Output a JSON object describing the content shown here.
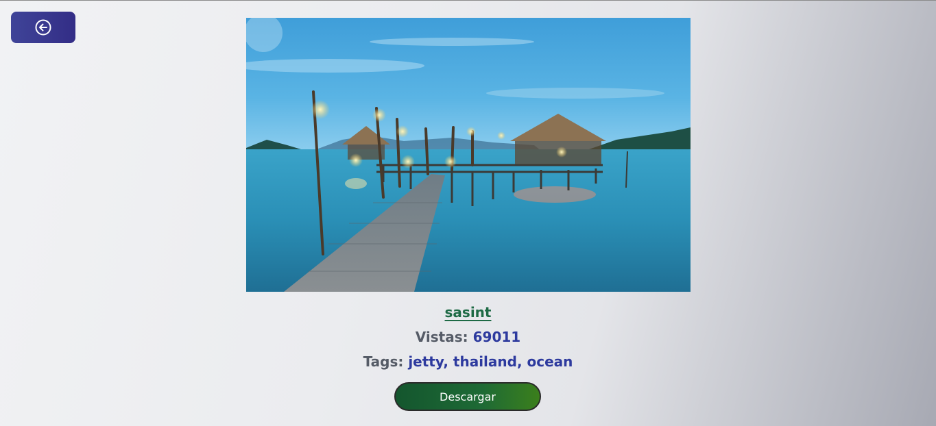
{
  "back_button": {
    "icon": "arrow-left-circle-icon"
  },
  "image": {
    "subject": "jetty"
  },
  "author": {
    "name": "sasint"
  },
  "views": {
    "label": "Vistas:",
    "value": "69011"
  },
  "tags": {
    "label": "Tags:",
    "value": "jetty, thailand, ocean"
  },
  "download": {
    "label": "Descargar"
  },
  "colors": {
    "back_button": "#3a3b92",
    "author": "#1e6a45",
    "value": "#2d3a9e",
    "download": "#1b6130"
  }
}
